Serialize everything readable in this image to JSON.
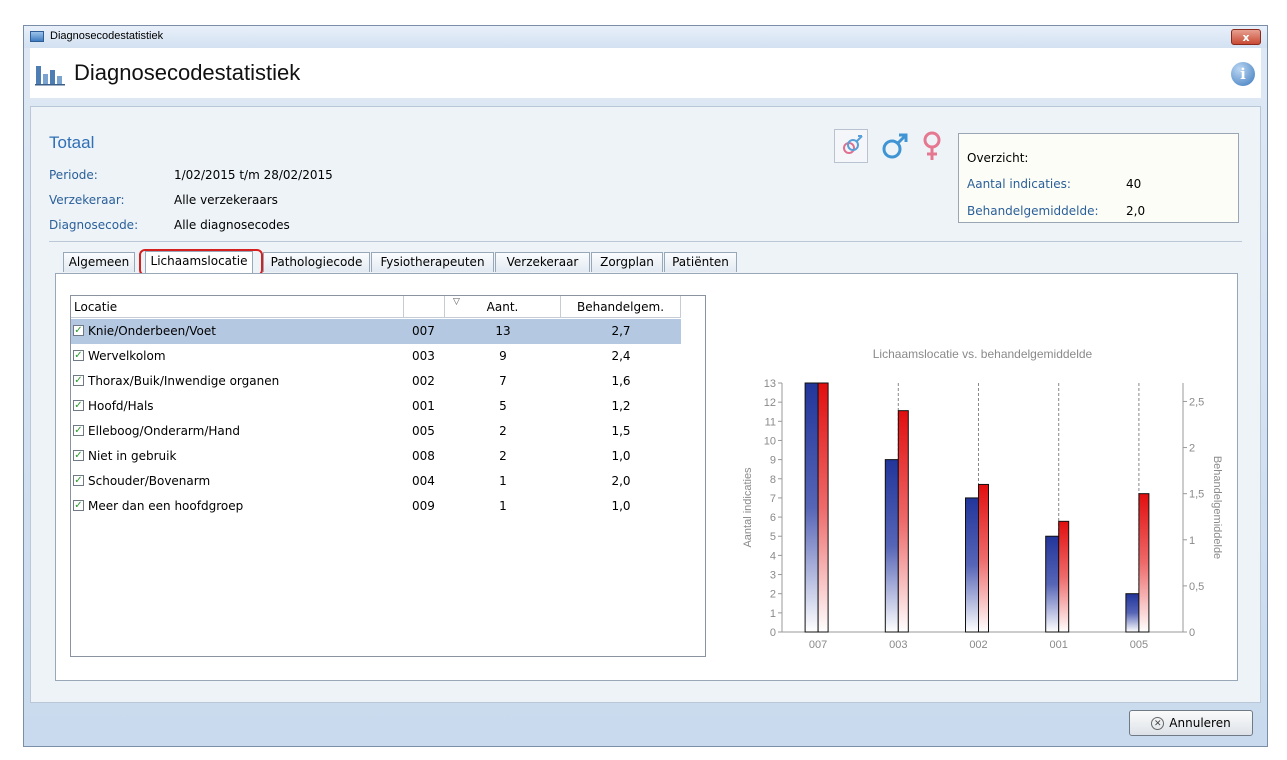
{
  "window": {
    "title": "Diagnosecodestatistiek",
    "close_label": "x"
  },
  "header": {
    "title": "Diagnosecodestatistiek",
    "info_label": "i"
  },
  "summary": {
    "heading": "Totaal",
    "fields": [
      {
        "label": "Periode:",
        "value": "1/02/2015 t/m 28/02/2015"
      },
      {
        "label": "Verzekeraar:",
        "value": "Alle verzekeraars"
      },
      {
        "label": "Diagnosecode:",
        "value": "Alle diagnosecodes"
      }
    ]
  },
  "gender_filters": [
    {
      "name": "both",
      "icon": "male-female-icon"
    },
    {
      "name": "male",
      "icon": "male-icon"
    },
    {
      "name": "female",
      "icon": "female-icon"
    }
  ],
  "overview": {
    "title": "Overzicht:",
    "rows": [
      {
        "label": "Aantal indicaties:",
        "value": "40"
      },
      {
        "label": "Behandelgemiddelde:",
        "value": "2,0"
      }
    ]
  },
  "tabs": [
    {
      "label": "Algemeen"
    },
    {
      "label": "Lichaamslocatie"
    },
    {
      "label": "Pathologiecode"
    },
    {
      "label": "Fysiotherapeuten"
    },
    {
      "label": "Verzekeraar"
    },
    {
      "label": "Zorgplan"
    },
    {
      "label": "Patiënten"
    }
  ],
  "table": {
    "columns": [
      "Locatie",
      "",
      "Aant.",
      "Behandelgem."
    ],
    "rows": [
      {
        "locatie": "Knie/Onderbeen/Voet",
        "code": "007",
        "aant": "13",
        "gem": "2,7",
        "checked": true,
        "selected": true
      },
      {
        "locatie": "Wervelkolom",
        "code": "003",
        "aant": "9",
        "gem": "2,4",
        "checked": true
      },
      {
        "locatie": "Thorax/Buik/Inwendige organen",
        "code": "002",
        "aant": "7",
        "gem": "1,6",
        "checked": true
      },
      {
        "locatie": "Hoofd/Hals",
        "code": "001",
        "aant": "5",
        "gem": "1,2",
        "checked": true
      },
      {
        "locatie": "Elleboog/Onderarm/Hand",
        "code": "005",
        "aant": "2",
        "gem": "1,5",
        "checked": true
      },
      {
        "locatie": "Niet in gebruik",
        "code": "008",
        "aant": "2",
        "gem": "1,0",
        "checked": true
      },
      {
        "locatie": "Schouder/Bovenarm",
        "code": "004",
        "aant": "1",
        "gem": "2,0",
        "checked": true
      },
      {
        "locatie": "Meer dan een hoofdgroep",
        "code": "009",
        "aant": "1",
        "gem": "1,0",
        "checked": true
      }
    ]
  },
  "chart_data": {
    "type": "bar",
    "title": "Lichaamslocatie vs. behandelgemiddelde",
    "categories": [
      "007",
      "003",
      "002",
      "001",
      "005"
    ],
    "series": [
      {
        "name": "Aantal indicaties",
        "values": [
          13,
          9,
          7,
          5,
          2
        ],
        "axis": "left",
        "color": "#2a3f9a"
      },
      {
        "name": "Behandelgemiddelde",
        "values": [
          2.7,
          2.4,
          1.6,
          1.2,
          1.5
        ],
        "axis": "right",
        "color": "#e01818"
      }
    ],
    "ylabel": "Aantal indicaties",
    "y2label": "Behandelgemiddelde",
    "ylim": [
      0,
      13
    ],
    "y2lim": [
      0,
      2.7
    ],
    "yticks": [
      "0",
      "1",
      "2",
      "3",
      "4",
      "5",
      "6",
      "7",
      "8",
      "9",
      "10",
      "11",
      "12",
      "13"
    ],
    "y2ticks": [
      "0",
      "0,5",
      "1",
      "1,5",
      "2",
      "2,5"
    ],
    "y2tick_values": [
      0,
      0.5,
      1,
      1.5,
      2,
      2.5
    ]
  },
  "footer": {
    "cancel_label": "Annuleren"
  }
}
